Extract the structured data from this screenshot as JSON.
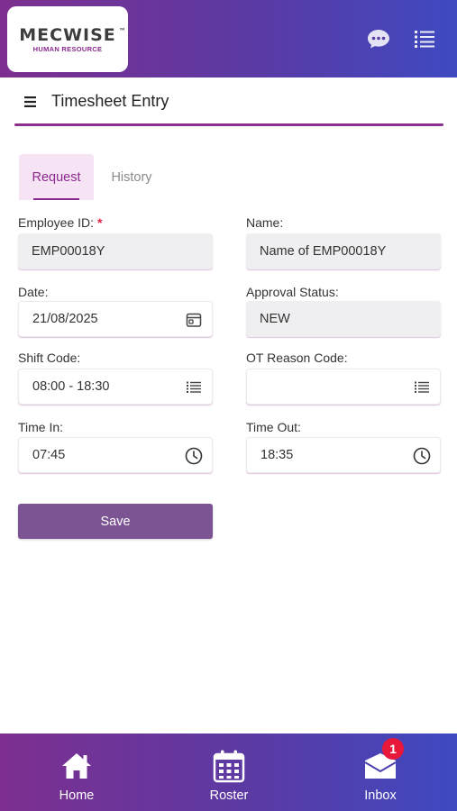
{
  "header": {
    "logo": {
      "main": "MECWISE",
      "tm": "™",
      "sub": "HUMAN RESOURCE"
    },
    "icons": {
      "chat": "chat-bubble-icon",
      "list": "list-icon"
    }
  },
  "titlebar": {
    "title": "Timesheet Entry",
    "menu_icon": "hamburger-menu-icon"
  },
  "tabs": [
    {
      "label": "Request",
      "active": true
    },
    {
      "label": "History",
      "active": false
    }
  ],
  "form": {
    "employee_id": {
      "label": "Employee ID:",
      "required_mark": "*",
      "value": "EMP00018Y"
    },
    "name": {
      "label": "Name:",
      "value": "Name of EMP00018Y"
    },
    "date": {
      "label": "Date:",
      "value": "21/08/2025",
      "icon": "calendar-icon"
    },
    "approval_status": {
      "label": "Approval Status:",
      "value": "NEW"
    },
    "shift_code": {
      "label": "Shift Code:",
      "value": "08:00 - 18:30",
      "icon": "list-icon"
    },
    "ot_reason_code": {
      "label": "OT Reason Code:",
      "value": "",
      "icon": "list-icon"
    },
    "time_in": {
      "label": "Time In:",
      "value": "07:45",
      "icon": "clock-icon"
    },
    "time_out": {
      "label": "Time Out:",
      "value": "18:35",
      "icon": "clock-icon"
    },
    "save_label": "Save"
  },
  "colors": {
    "brand_purple": "#8a2a8f",
    "header_gradient_start": "#7d2f8f",
    "header_gradient_end": "#3f49c0",
    "save_button": "#7d5493",
    "badge": "#e8183a"
  },
  "bottom_nav": {
    "items": [
      {
        "label": "Home",
        "icon": "home-icon"
      },
      {
        "label": "Roster",
        "icon": "calendar-icon"
      },
      {
        "label": "Inbox",
        "icon": "mail-icon",
        "badge": "1"
      }
    ]
  }
}
